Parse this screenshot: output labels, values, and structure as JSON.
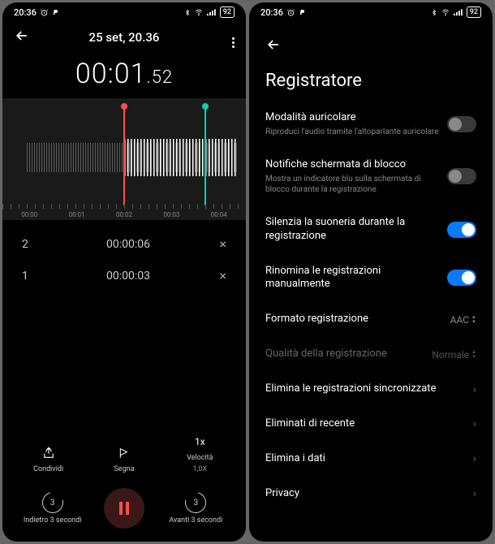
{
  "status": {
    "time": "20:36",
    "battery": "92"
  },
  "player": {
    "date_title": "25 set, 20.36",
    "timer_main": "00:01",
    "timer_ms": ".52",
    "ruler": [
      "00:00",
      "00:01",
      "00:02",
      "00:03",
      "00:04"
    ],
    "marks": [
      {
        "idx": "2",
        "time": "00:00:06"
      },
      {
        "idx": "1",
        "time": "00:00:03"
      }
    ],
    "controls": {
      "share": "Condividi",
      "mark": "Segna",
      "speed_top": "1x",
      "speed_label": "Velocità",
      "speed_value": "1,0X",
      "back3": "Indietro 3 secondi",
      "fwd3": "Avanti 3 secondi",
      "skip_num": "3"
    }
  },
  "settings": {
    "title": "Registratore",
    "items": {
      "earpiece": {
        "label": "Modalità auricolare",
        "desc": "Riproduci l'audio tramite l'altoparlante auricolare"
      },
      "lockscreen": {
        "label": "Notifiche schermata di blocco",
        "desc": "Mostra un indicatore blu sulla schermata di blocco durante la registrazione"
      },
      "silence": {
        "label": "Silenzia la suoneria durante la registrazione"
      },
      "rename": {
        "label": "Rinomina le registrazioni manualmente"
      },
      "format": {
        "label": "Formato registrazione",
        "value": "AAC"
      },
      "quality": {
        "label": "Qualità della registrazione",
        "value": "Normale"
      },
      "del_synced": {
        "label": "Elimina le registrazioni sincronizzate"
      },
      "del_recent": {
        "label": "Eliminati di recente"
      },
      "del_data": {
        "label": "Elimina i dati"
      },
      "privacy": {
        "label": "Privacy"
      }
    }
  }
}
